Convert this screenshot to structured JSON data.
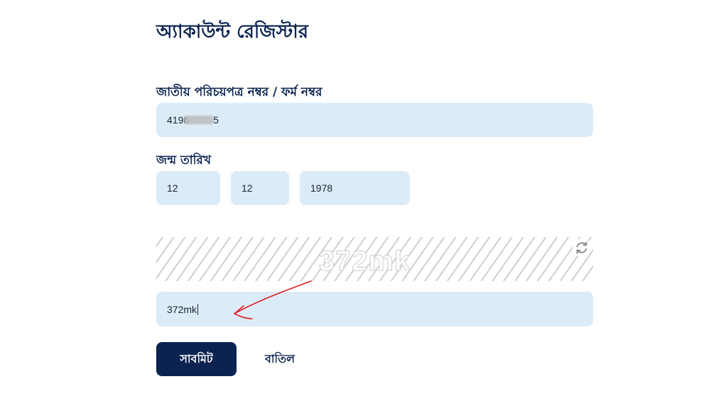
{
  "page": {
    "title": "অ্যাকাউন্ট রেজিস্টার"
  },
  "nid": {
    "label": "জাতীয় পরিচয়পত্র নম্বর / ফর্ম নম্বর",
    "value_prefix": "4198",
    "value_suffix": "5"
  },
  "dob": {
    "label": "জন্ম তারিখ",
    "day": "12",
    "month": "12",
    "year": "1978"
  },
  "captcha": {
    "image_text": "372mk",
    "input_value": "372mk",
    "refresh_icon": "refresh-icon"
  },
  "annotation": {
    "arrow_color": "#e02020"
  },
  "buttons": {
    "submit_label": "সাবমিট",
    "cancel_label": "বাতিল"
  },
  "colors": {
    "primary": "#0b2350",
    "field_bg": "#dcebf8"
  }
}
